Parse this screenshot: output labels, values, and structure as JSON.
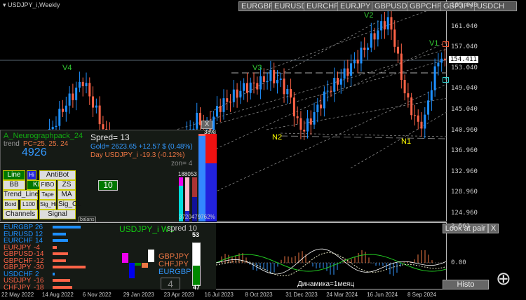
{
  "window": {
    "title": "USDJPY_i,Weekly"
  },
  "pair_tabs": [
    "EURGBP",
    "EURUSD",
    "EURCHF",
    "EURJPY",
    "GBPUSD",
    "GBPCHF",
    "GBPJPY",
    "USDCH"
  ],
  "price_axis": [
    "165.040",
    "161.040",
    "157.040",
    "153.040",
    "149.040",
    "145.040",
    "140.960",
    "136.960",
    "132.960",
    "128.960",
    "124.960"
  ],
  "current_price": "154.411",
  "labels": {
    "v4": "V4",
    "v3": "V3",
    "v2": "V2",
    "v1": "V1",
    "n2": "N2",
    "n1": "N1"
  },
  "chart_data": {
    "type": "candlestick",
    "symbol": "USDJPY_i",
    "timeframe": "Weekly",
    "keypoints": [
      [
        0,
        127
      ],
      [
        8,
        133
      ],
      [
        18,
        145
      ],
      [
        24,
        150.5
      ],
      [
        27,
        146
      ],
      [
        32,
        138
      ],
      [
        36,
        135
      ],
      [
        38,
        131.5
      ],
      [
        42,
        130
      ],
      [
        46,
        133
      ],
      [
        50,
        134
      ],
      [
        54,
        139
      ],
      [
        58,
        143
      ],
      [
        62,
        141
      ],
      [
        64,
        145
      ],
      [
        68,
        147
      ],
      [
        72,
        149
      ],
      [
        76,
        149.8
      ],
      [
        80,
        151.3
      ],
      [
        83,
        150
      ],
      [
        86,
        147
      ],
      [
        88,
        142
      ],
      [
        90,
        141
      ],
      [
        93,
        144
      ],
      [
        97,
        148.5
      ],
      [
        101,
        151
      ],
      [
        105,
        154
      ],
      [
        109,
        157.5
      ],
      [
        113,
        161
      ],
      [
        115,
        162
      ],
      [
        117,
        158
      ],
      [
        119,
        151
      ],
      [
        121,
        146
      ],
      [
        123,
        143.5
      ],
      [
        124,
        141.7
      ],
      [
        126,
        143
      ],
      [
        127,
        146.5
      ],
      [
        128,
        149.5
      ],
      [
        129,
        152
      ],
      [
        130,
        154.5
      ],
      [
        131,
        155
      ],
      [
        132,
        154.4
      ]
    ],
    "ylim": [
      124.96,
      165.04
    ],
    "x_ticks": [
      "22 May 2022",
      "14 Aug 2022",
      "6 Nov 2022",
      "29 Jan 2023",
      "23 Apr 2023",
      "16 Jul 2023",
      "8 Oct 2023",
      "31 Dec 2023",
      "24 Mar 2024",
      "16 Jun 2024",
      "8 Sep 2024"
    ]
  },
  "info": {
    "indicator": "A_Neurographpack_24",
    "trend_label": "trend",
    "pc": "PC=25. 25. 24",
    "big_number": "4926",
    "spred": "Spred= 13",
    "gold": "Gold= 2623.65 +12.57 $ (0.48%)",
    "day": "Day USDJPY_i  -19.3 (-0.12%)",
    "zon": "zon= 4",
    "box_value": "10",
    "col_tops": [
      "1",
      "8",
      "8",
      "0",
      "53"
    ],
    "col_bottoms": [
      "3",
      "7",
      "20",
      "47",
      "97",
      "62%"
    ],
    "pct_top": "38%",
    "close": "X",
    "balans": "balans"
  },
  "buttons": [
    "Line",
    "Hi",
    "AntiBot",
    "BB",
    "KD",
    "FIBO",
    "ZS",
    "Trend_Line",
    "Tape",
    "MA",
    "Bord",
    "L100",
    "Sig_Hi",
    "Sig_CL",
    "Channels",
    "Signal"
  ],
  "strength": [
    {
      "pair": "EURGBP",
      "v": "26",
      "n": 26
    },
    {
      "pair": "EURUSD",
      "v": "12",
      "n": 12
    },
    {
      "pair": "EURCHF",
      "v": "14",
      "n": 14
    },
    {
      "pair": "EURJPY",
      "v": "-4",
      "n": -4
    },
    {
      "pair": "GBPUSD",
      "v": "-14",
      "n": -14
    },
    {
      "pair": "GBPCHF",
      "v": "-12",
      "n": -12
    },
    {
      "pair": "GBPJPY",
      "v": "-30",
      "n": -30
    },
    {
      "pair": "USDCHF",
      "v": "2",
      "n": 2
    },
    {
      "pair": "USDJPY",
      "v": "-16",
      "n": -16
    },
    {
      "pair": "CHFJPY",
      "v": "-18",
      "n": -18
    }
  ],
  "bottom": {
    "symbol": "USDJPY_i  W1",
    "spred": "spred 10",
    "pairs": [
      "GBPJPY",
      "CHFJPY",
      "EURGBP"
    ],
    "box": "4",
    "gauge_top": "53",
    "gauge_bottom": "47",
    "gauge_value": 53
  },
  "osc": {
    "axis_top": "3.561",
    "axis_zero": "0.00",
    "caption": "Динамика=1меяц",
    "look": "Look at pair",
    "close": "X",
    "histo": "Histo"
  },
  "colors": {
    "bull": "#1e90ff",
    "bear": "#ff6347",
    "label": "#32cd32",
    "yellow": "#ffff00"
  }
}
